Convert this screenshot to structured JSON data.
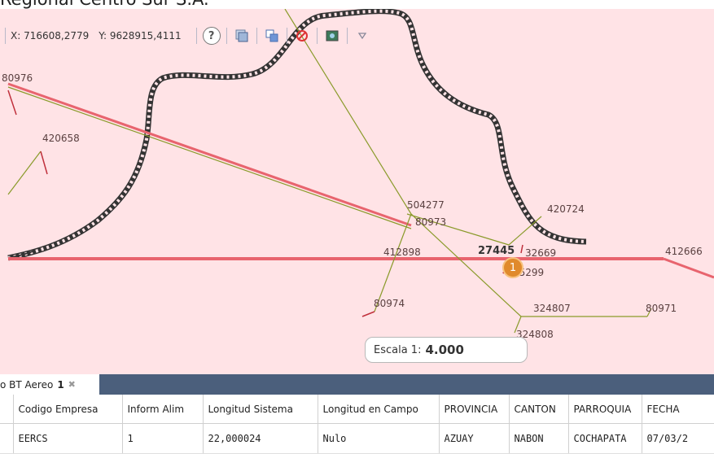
{
  "header": {
    "title": "Regional Centro Sur S.A."
  },
  "toolbar": {
    "x_coord": "X: 716608,2779",
    "y_coord": "Y: 9628915,4111",
    "help_label": "?"
  },
  "map": {
    "labels": [
      {
        "id": "l-80976",
        "text": "80976"
      },
      {
        "id": "l-420658",
        "text": "420658"
      },
      {
        "id": "l-504277",
        "text": "504277"
      },
      {
        "id": "l-80973",
        "text": "80973"
      },
      {
        "id": "l-420724",
        "text": "420724"
      },
      {
        "id": "l-412898",
        "text": "412898"
      },
      {
        "id": "l-27445",
        "text": "27445"
      },
      {
        "id": "l-32669",
        "text": "32669"
      },
      {
        "id": "l-412666",
        "text": "412666"
      },
      {
        "id": "l-75299",
        "text": "75299"
      },
      {
        "id": "l-80974",
        "text": "80974"
      },
      {
        "id": "l-324807",
        "text": "324807"
      },
      {
        "id": "l-80971",
        "text": "80971"
      },
      {
        "id": "l-324808",
        "text": "324808"
      }
    ],
    "cluster_count": "1",
    "scale_label": "Escala 1:",
    "scale_value": "4.000",
    "colors": {
      "background": "#ffe3e6",
      "red_line": "#e8646e",
      "olive_line": "#8a9a2a",
      "road": "#333333",
      "marker": "#e08a2c"
    }
  },
  "tab": {
    "label": "o BT Aereo",
    "count": "1",
    "close": "✖"
  },
  "table": {
    "columns": [
      "Codigo Empresa",
      "Inform Alim",
      "Longitud Sistema",
      "Longitud en Campo",
      "PROVINCIA",
      "CANTON",
      "PARROQUIA",
      "FECHA"
    ],
    "rows": [
      [
        "EERCS",
        "1",
        "22,000024",
        "Nulo",
        "AZUAY",
        "NABON",
        "COCHAPATA",
        "07/03/2"
      ]
    ]
  }
}
